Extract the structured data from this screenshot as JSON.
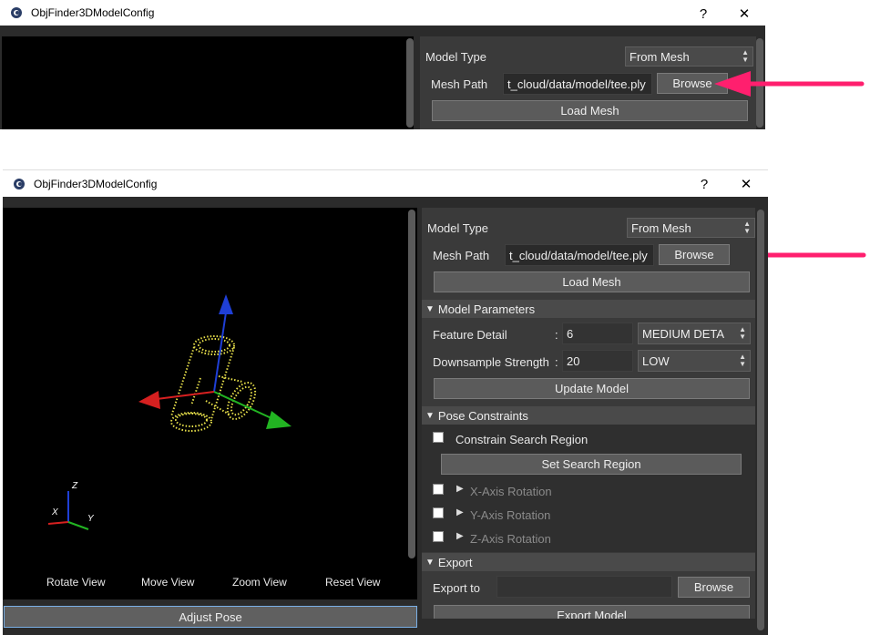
{
  "window_top": {
    "title": "ObjFinder3DModelConfig",
    "help": "?",
    "close": "✕",
    "model_type_label": "Model Type",
    "model_type_value": "From Mesh",
    "mesh_path_label": "Mesh Path",
    "mesh_path_value": "t_cloud/data/model/tee.ply",
    "browse": "Browse",
    "load_mesh": "Load Mesh"
  },
  "window_main": {
    "title": "ObjFinder3DModelConfig",
    "help": "?",
    "close": "✕",
    "model_type_label": "Model Type",
    "model_type_value": "From Mesh",
    "mesh_path_label": "Mesh Path",
    "mesh_path_value": "t_cloud/data/model/tee.ply",
    "browse": "Browse",
    "load_mesh": "Load Mesh",
    "model_params": {
      "header": "Model Parameters",
      "feature_detail_label": "Feature Detail",
      "feature_detail_value": "6",
      "feature_detail_level": "MEDIUM DETA",
      "downsample_label": "Downsample Strength",
      "downsample_value": "20",
      "downsample_level": "LOW",
      "colon": ":",
      "update_model": "Update Model"
    },
    "pose_constraints": {
      "header": "Pose Constraints",
      "constrain_label": "Constrain Search Region",
      "set_region": "Set Search Region",
      "x_rot": "X-Axis Rotation",
      "y_rot": "Y-Axis Rotation",
      "z_rot": "Z-Axis Rotation"
    },
    "export": {
      "header": "Export",
      "export_to_label": "Export to",
      "export_to_value": "",
      "browse": "Browse",
      "export_model": "Export Model"
    },
    "view_controls": {
      "rotate": "Rotate View",
      "move": "Move View",
      "zoom": "Zoom View",
      "reset": "Reset View"
    },
    "adjust_pose": "Adjust Pose",
    "axis_labels": {
      "z": "Z",
      "x": "X",
      "y": "Y"
    }
  },
  "colors": {
    "annotation_arrow": "#ff1f6e",
    "axis_x": "#d62020",
    "axis_y": "#22b422",
    "axis_z": "#1f3fd6",
    "point_cloud": "#e8e04a"
  },
  "icons": [
    "app-icon",
    "combo-arrow-icon",
    "triangle-down-icon",
    "triangle-right-icon",
    "checkbox-icon",
    "annotation-arrow-icon"
  ]
}
